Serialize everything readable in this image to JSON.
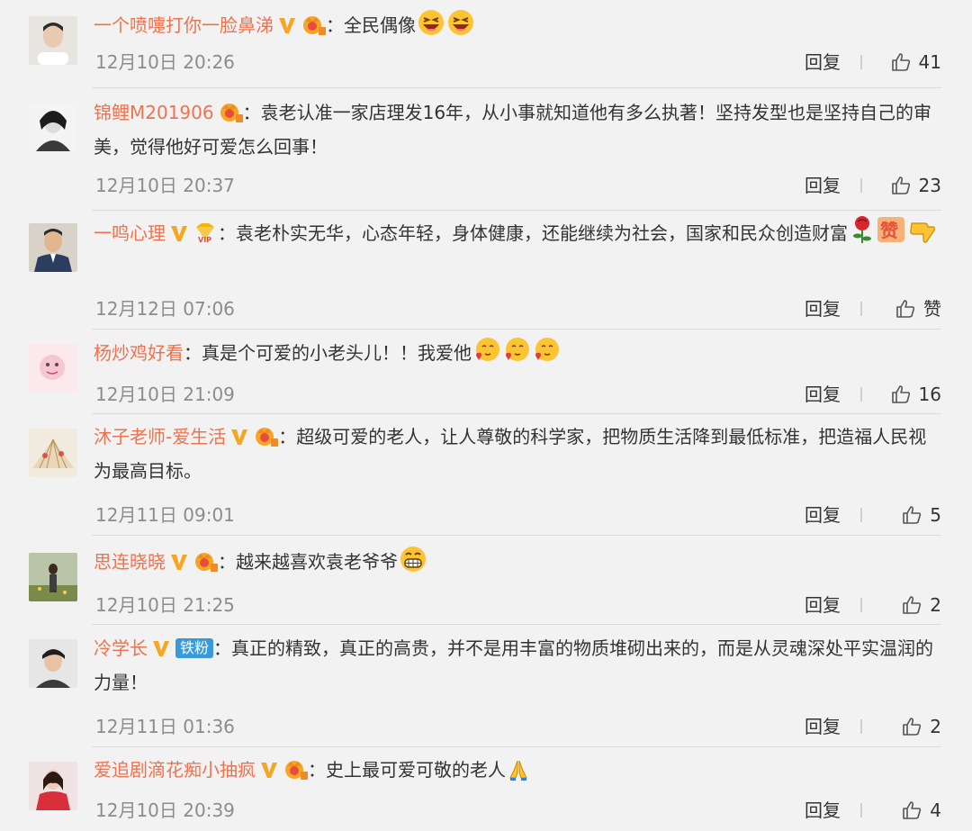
{
  "reply_label": "回复",
  "colors": {
    "name": "#eb7350",
    "time": "#8c8c8c",
    "background": "#f2f2f2",
    "vip_gold": "#f5a623",
    "fan_blue": "#3a9ad9"
  },
  "comments": [
    {
      "user": "一个喷嚏打你一脸鼻涕",
      "badges": [
        "verified-v-icon",
        "member-crown-icon"
      ],
      "colon": "：",
      "text": "全民偶像",
      "emoji": [
        "laughing-face-icon",
        "laughing-face-icon"
      ],
      "time": "12月10日 20:26",
      "likes": "41"
    },
    {
      "user": "锦鲤M201906",
      "badges": [
        "member-crown-icon"
      ],
      "colon": "：",
      "text": "袁老认准一家店理发16年，从小事就知道他有多么执著！坚持发型也是坚持自己的审美，觉得他好可爱怎么回事！",
      "emoji": [],
      "time": "12月10日 20:37",
      "likes": "23"
    },
    {
      "user": "一鸣心理",
      "badges": [
        "verified-v-icon",
        "vip-diamond-icon"
      ],
      "colon": "：",
      "text": "袁老朴实无华，心态年轻，身体健康，还能继续为社会，国家和民众创造财富",
      "emoji": [
        "rose-icon",
        "zan-icon",
        "thumbs-down-hand-icon"
      ],
      "time": "12月12日 07:06",
      "likes": "赞"
    },
    {
      "user": "杨炒鸡好看",
      "badges": [],
      "colon": "：",
      "text": "真是个可爱的小老头儿！！我爱他",
      "emoji": [
        "love-face-icon",
        "love-face-icon",
        "love-face-icon"
      ],
      "time": "12月10日 21:09",
      "likes": "16"
    },
    {
      "user": "沐子老师-爱生活",
      "badges": [
        "verified-v-icon",
        "member-crown-icon"
      ],
      "colon": "：",
      "text": "超级可爱的老人，让人尊敬的科学家，把物质生活降到最低标准，把造福人民视为最高目标。",
      "emoji": [],
      "time": "12月11日 09:01",
      "likes": "5"
    },
    {
      "user": "思连晓晓",
      "badges": [
        "verified-v-icon",
        "member-crown-icon"
      ],
      "colon": "：",
      "text": "越来越喜欢袁老爷爷",
      "emoji": [
        "grin-face-icon"
      ],
      "time": "12月10日 21:25",
      "likes": "2"
    },
    {
      "user": "冷学长",
      "badges": [
        "verified-v-icon"
      ],
      "fan_badge": "铁粉",
      "colon": "：",
      "text": "真正的精致，真正的高贵，并不是用丰富的物质堆砌出来的，而是从灵魂深处平实温润的力量！",
      "emoji": [],
      "time": "12月11日 01:36",
      "likes": "2"
    },
    {
      "user": "爱追剧滴花痴小抽疯",
      "badges": [
        "verified-v-icon",
        "member-crown-icon"
      ],
      "colon": "：",
      "text": "史上最可爱可敬的老人",
      "emoji": [
        "pray-hands-icon"
      ],
      "time": "12月10日 20:39",
      "likes": "4"
    }
  ]
}
